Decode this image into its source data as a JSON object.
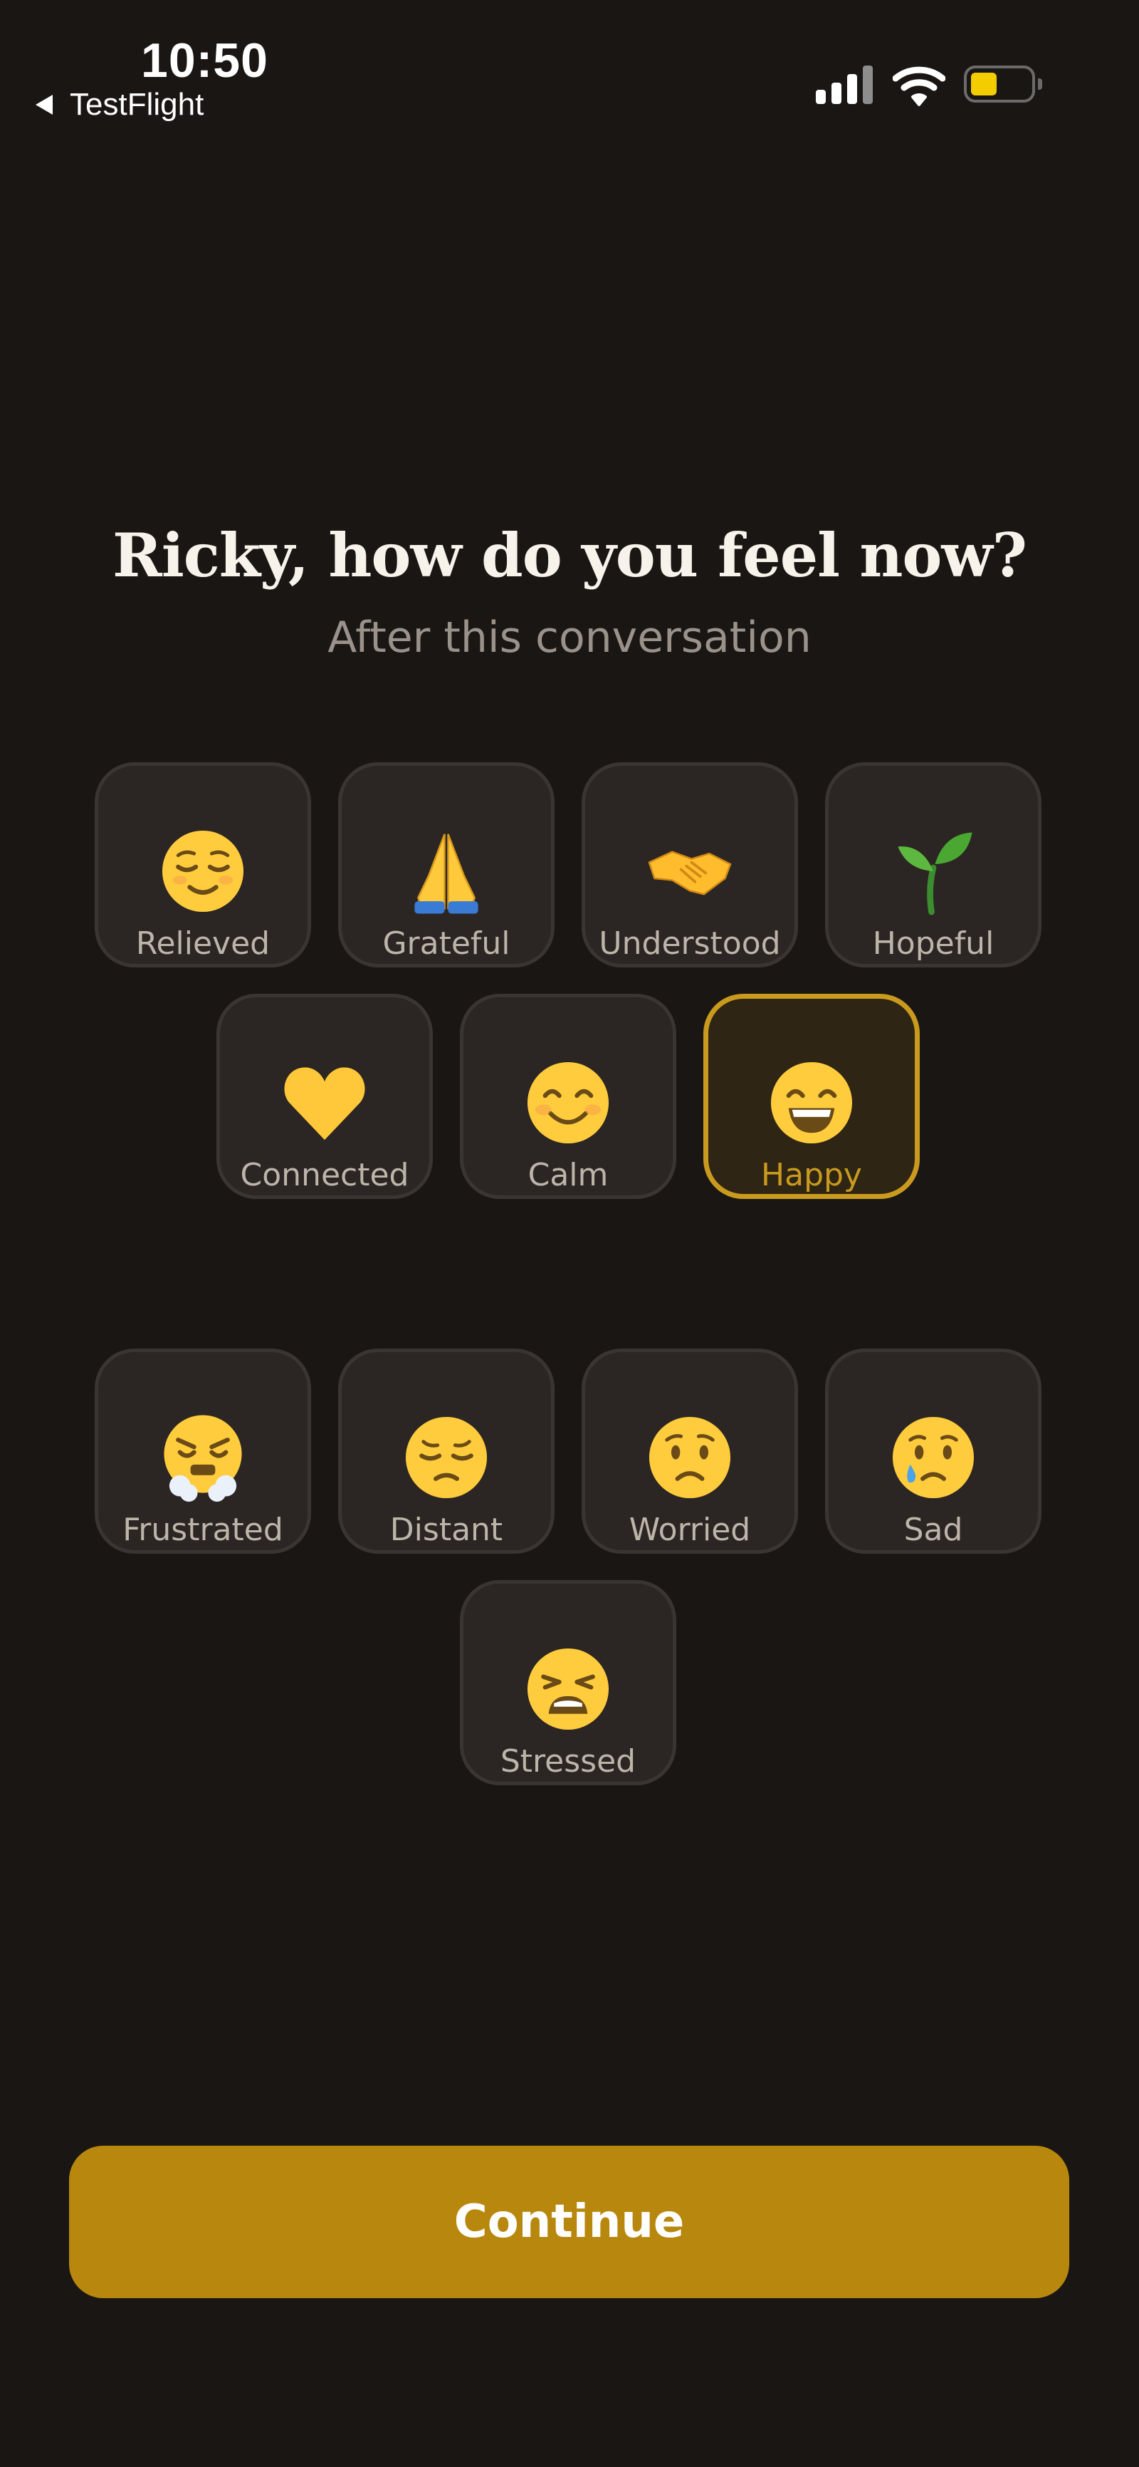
{
  "status_bar": {
    "time": "10:50",
    "back_label": "TestFlight",
    "icons": [
      "signal-icon",
      "wifi-icon",
      "battery-icon"
    ]
  },
  "header": {
    "title": "Ricky, how do you feel now?",
    "subtitle": "After this conversation"
  },
  "positive_moods": [
    {
      "label": "Relieved",
      "icon": "relieved-face-icon"
    },
    {
      "label": "Grateful",
      "icon": "folded-hands-icon"
    },
    {
      "label": "Understood",
      "icon": "handshake-icon"
    },
    {
      "label": "Hopeful",
      "icon": "seedling-icon"
    },
    {
      "label": "Connected",
      "icon": "yellow-heart-icon"
    },
    {
      "label": "Calm",
      "icon": "smiling-face-icon"
    },
    {
      "label": "Happy",
      "icon": "grinning-face-icon",
      "selected": true
    }
  ],
  "negative_moods": [
    {
      "label": "Frustrated",
      "icon": "steam-face-icon"
    },
    {
      "label": "Distant",
      "icon": "pensive-face-icon"
    },
    {
      "label": "Worried",
      "icon": "worried-face-icon"
    },
    {
      "label": "Sad",
      "icon": "crying-face-icon"
    },
    {
      "label": "Stressed",
      "icon": "weary-face-icon"
    }
  ],
  "continue_label": "Continue",
  "colors": {
    "background": "#1a1614",
    "tile": "#2b2623",
    "accent": "#c99a1d",
    "button": "#b8870e"
  }
}
